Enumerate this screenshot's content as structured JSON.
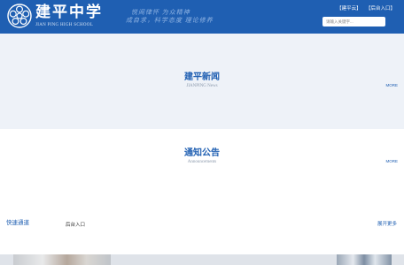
{
  "header": {
    "school_name_cn": "建平中学",
    "school_name_en": "JIAN PING HIGH SCHOOL",
    "motto_line1": "悦闻律怀  为众精神",
    "motto_line2": "成自求，科学态度  理论修养",
    "links": [
      "【建平云】",
      "【后台入口】"
    ],
    "search_placeholder": "请输入关键字...",
    "background_color": "#1f5fb2"
  },
  "news": {
    "title": "建平新闻",
    "subtitle": "JIANPING News",
    "more_label": "MORE"
  },
  "notice": {
    "title": "通知公告",
    "subtitle": "Announcements",
    "more_label": "MORE"
  },
  "quick_access": {
    "title": "快速通道",
    "link": "后台入口",
    "expand_label": "展开更多"
  }
}
